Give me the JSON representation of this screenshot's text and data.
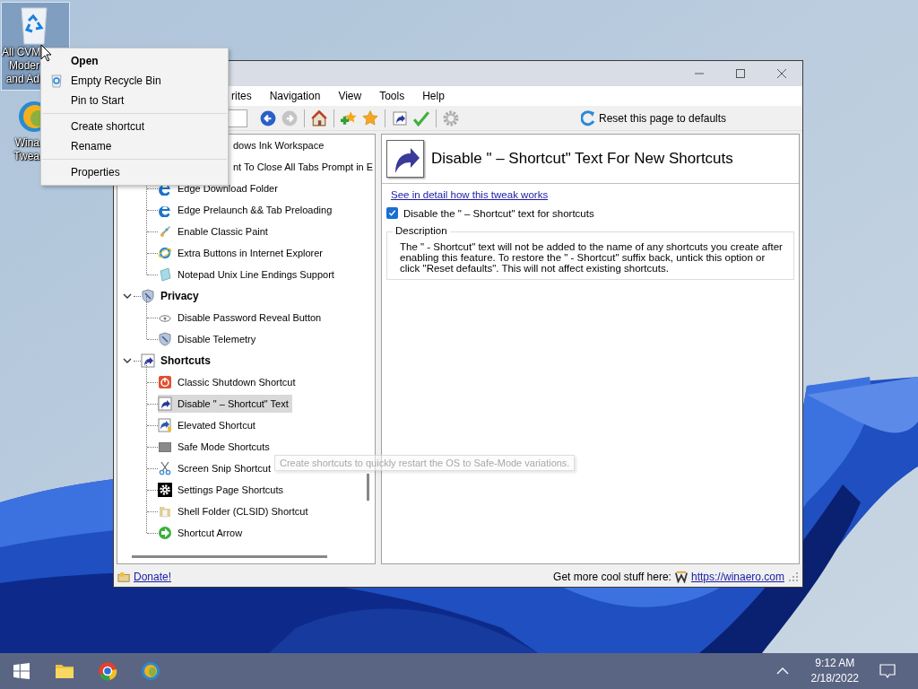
{
  "desktop_icons": [
    {
      "label_lines": [
        "All CVM",
        "Moder",
        "and Ad"
      ],
      "selected": true
    },
    {
      "label_lines": [
        "Wina",
        "Twea"
      ],
      "selected": false
    }
  ],
  "context_menu": {
    "items": [
      {
        "kind": "default",
        "label": "Open"
      },
      {
        "kind": "icon",
        "label": "Empty Recycle Bin"
      },
      {
        "kind": "plain",
        "label": "Pin to Start"
      },
      {
        "kind": "separator"
      },
      {
        "kind": "plain",
        "label": "Create shortcut"
      },
      {
        "kind": "plain",
        "label": "Rename"
      },
      {
        "kind": "separator"
      },
      {
        "kind": "plain",
        "label": "Properties"
      }
    ]
  },
  "window": {
    "menu": [
      "rites",
      "Navigation",
      "View",
      "Tools",
      "Help"
    ],
    "nav_buttons": [
      {
        "disabled": false
      },
      {
        "disabled": true
      }
    ],
    "reset_button": "Reset this page to defaults",
    "tree": [
      {
        "children": [
          {
            "kind": "clipped",
            "label": "dows Ink Workspace",
            "selected": false
          },
          {
            "kind": "clipped",
            "label": "nt To Close All Tabs Prompt in E",
            "selected": false
          },
          {
            "kind": "item",
            "label": "Edge Download Folder",
            "selected": false
          },
          {
            "kind": "item",
            "label": "Edge Prelaunch && Tab Preloading",
            "selected": false
          },
          {
            "kind": "item",
            "label": "Enable Classic Paint",
            "selected": false
          },
          {
            "kind": "item",
            "label": "Extra Buttons in Internet Explorer",
            "selected": false
          },
          {
            "kind": "item",
            "label": "Notepad Unix Line Endings Support",
            "selected": false
          }
        ]
      },
      {
        "label": "Privacy",
        "expanded": true,
        "selected": false,
        "children": [
          {
            "kind": "item",
            "label": "Disable Password Reveal Button",
            "selected": false
          },
          {
            "kind": "item",
            "label": "Disable Telemetry",
            "selected": false
          }
        ]
      },
      {
        "label": "Shortcuts",
        "expanded": true,
        "selected": false,
        "children": [
          {
            "kind": "item",
            "label": "Classic Shutdown Shortcut",
            "selected": false
          },
          {
            "kind": "item",
            "label": "Disable \" – Shortcut\" Text",
            "selected": true
          },
          {
            "kind": "item",
            "label": "Elevated Shortcut",
            "selected": false
          },
          {
            "kind": "item",
            "label": "Safe Mode Shortcuts",
            "selected": false
          },
          {
            "kind": "item",
            "label": "Screen Snip Shortcut",
            "selected": false
          },
          {
            "kind": "item",
            "label": "Settings Page Shortcuts",
            "selected": false
          },
          {
            "kind": "item",
            "label": "Shell Folder (CLSID) Shortcut",
            "selected": false
          },
          {
            "kind": "item",
            "label": "Shortcut Arrow",
            "selected": false
          }
        ]
      }
    ],
    "detail": {
      "title": "Disable \" – Shortcut\" Text For New Shortcuts",
      "link": "See in detail how this tweak works",
      "options": [
        {
          "label": "Disable the \" – Shortcut\" text for shortcuts",
          "checked": true
        }
      ],
      "description": {
        "legend": "Description",
        "text": "The \" - Shortcut\" text will not be added to the name of any shortcuts you create after enabling this feature. To restore the \" - Shortcut\" suffix back, untick this option or click \"Reset defaults\". This will not affect existing shortcuts."
      }
    },
    "status_bar": {
      "donate": "Donate!",
      "promo": "Get more cool stuff here:",
      "url": "https://winaero.com"
    }
  },
  "tooltip": {
    "text": "Create shortcuts to quickly restart the OS to Safe-Mode variations."
  },
  "taskbar": {
    "time": "9:12 AM",
    "date": "2/18/2022"
  }
}
